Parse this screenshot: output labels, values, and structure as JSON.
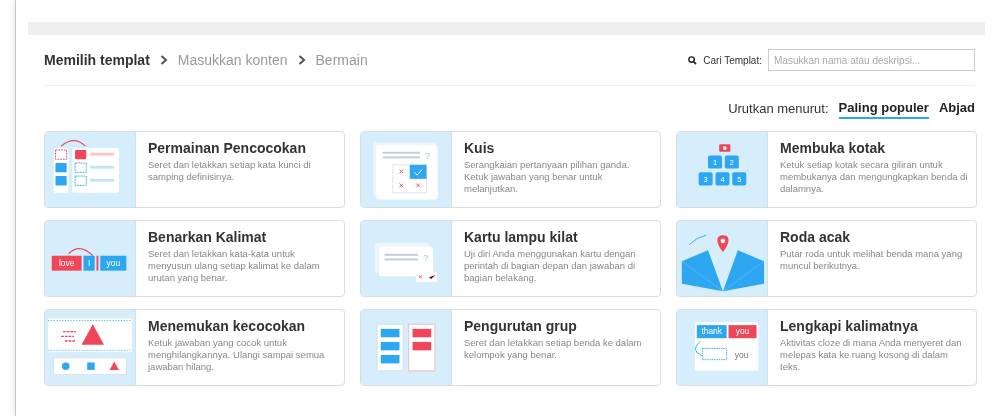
{
  "breadcrumb": [
    {
      "label": "Memilih templat",
      "selected": true
    },
    {
      "label": "Masukkan konten",
      "selected": false
    },
    {
      "label": "Bermain",
      "selected": false
    }
  ],
  "search": {
    "label": "Cari Templat:",
    "placeholder": "Masukkan nama atau deskripsi..."
  },
  "sort": {
    "label": "Urutkan menurut:",
    "options": [
      {
        "label": "Paling populer",
        "selected": true
      },
      {
        "label": "Abjad",
        "selected": false
      }
    ]
  },
  "templates": [
    {
      "kind": "matching",
      "title": "Permainan Pencocokan",
      "description": "Seret dan letakkan setiap kata kunci di samping definisinya."
    },
    {
      "kind": "quiz",
      "title": "Kuis",
      "description": "Serangkaian pertanyaan pilihan ganda. Ketuk jawaban yang benar untuk melanjutkan.",
      "art_labels": [
        "?"
      ]
    },
    {
      "kind": "boxes",
      "title": "Membuka kotak",
      "description": "Ketuk setiap kotak secara giliran untuk membukanya dan mengungkapkan benda di dalamnya.",
      "art_labels": [
        "1",
        "2",
        "3",
        "4",
        "5"
      ]
    },
    {
      "kind": "sentence",
      "title": "Benarkan Kalimat",
      "description": "Seret dan letakkan kata-kata untuk menyusun ulang setiap kalimat ke dalam urutan yang benar.",
      "art_labels": [
        "love",
        "I",
        "you"
      ]
    },
    {
      "kind": "flashcard",
      "title": "Kartu lampu kilat",
      "description": "Uji diri Anda menggunakan kartu dengan perintah di bagian depan dan jawaban di bagian belakang.",
      "art_labels": [
        "?"
      ]
    },
    {
      "kind": "wheel",
      "title": "Roda acak",
      "description": "Putar roda untuk melihat benda mana yang muncul berikutnya."
    },
    {
      "kind": "findmatch",
      "title": "Menemukan kecocokan",
      "description": "Ketuk jawaban yang cocok untuk menghilangkannya. Ulangi sampai semua jawaban hilang."
    },
    {
      "kind": "groupsort",
      "title": "Pengurutan grup",
      "description": "Seret dan letakkan setiap benda ke dalam kelompok yang benar."
    },
    {
      "kind": "cloze",
      "title": "Lengkapi kalimatnya",
      "description": "Aktivitas cloze di mana Anda menyeret dan melepas kata ke ruang kosong di dalam teks.",
      "art_labels": [
        "thank",
        "you",
        "you"
      ]
    }
  ]
}
